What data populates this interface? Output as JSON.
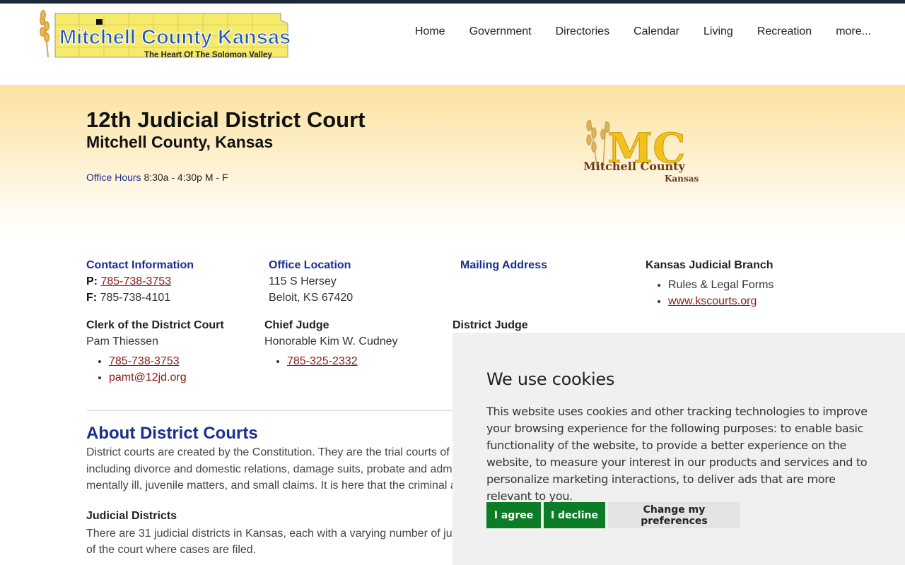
{
  "site": {
    "logo_title": "Mitchell County Kansas",
    "logo_tagline": "The Heart Of The Solomon Valley"
  },
  "nav": {
    "items": [
      "Home",
      "Government",
      "Directories",
      "Calendar",
      "Living",
      "Recreation",
      "more..."
    ]
  },
  "hero": {
    "title": "12th Judicial District Court",
    "subtitle": "Mitchell County, Kansas",
    "hours_label": "Office Hours",
    "hours_value": "8:30a - 4:30p  M - F",
    "badge_line1": "Mitchell County",
    "badge_line2": "Kansas",
    "badge_mono": "MC"
  },
  "contact": {
    "heading": "Contact Information",
    "phone_label": "P:",
    "phone": "785-738-3753",
    "fax_label": "F:",
    "fax": "785-738-4101"
  },
  "location": {
    "heading": "Office Location",
    "line1": "115 S Hersey",
    "line2": "Beloit, KS 67420"
  },
  "mailing": {
    "heading": "Mailing Address"
  },
  "judicial_branch": {
    "heading": "Kansas Judicial Branch",
    "item1": "Rules & Legal Forms",
    "item2": "www.kscourts.org"
  },
  "clerk": {
    "heading": "Clerk of the District Court",
    "name": "Pam Thiessen",
    "phone": "785-738-3753",
    "email": "pamt@12jd.org"
  },
  "chief_judge": {
    "heading": "Chief Judge",
    "name": "Honorable Kim W. Cudney",
    "phone": "785-325-2332"
  },
  "district_judge": {
    "heading": "District Judge"
  },
  "about": {
    "title": "About District Courts",
    "line1": "District courts are created by the Constitution. They are the trial courts of",
    "line2": "including divorce and domestic relations, damage suits, probate and adm",
    "line3": "mentally ill, juvenile matters, and small claims. It is here that the criminal a"
  },
  "judicial_districts": {
    "title": "Judicial Districts",
    "line1": "There are 31 judicial districts in Kansas, each with a varying number of ju",
    "line2": "of the court where cases are filed."
  },
  "cookie": {
    "title": "We use cookies",
    "body": "This website uses cookies and other tracking technologies to improve your browsing experience for the following purposes: to enable basic functionality of the website, to provide a better experience on the website, to measure your interest in our products and services and to personalize marketing interactions, to deliver ads that are more relevant to you.",
    "agree": "I agree",
    "decline": "I decline",
    "prefs": "Change my preferences"
  },
  "colors": {
    "accent_blue": "#1a2e8f",
    "link_red": "#8b1a1a",
    "button_green": "#0d7c27",
    "hero_gold": "#fbe2a0"
  }
}
